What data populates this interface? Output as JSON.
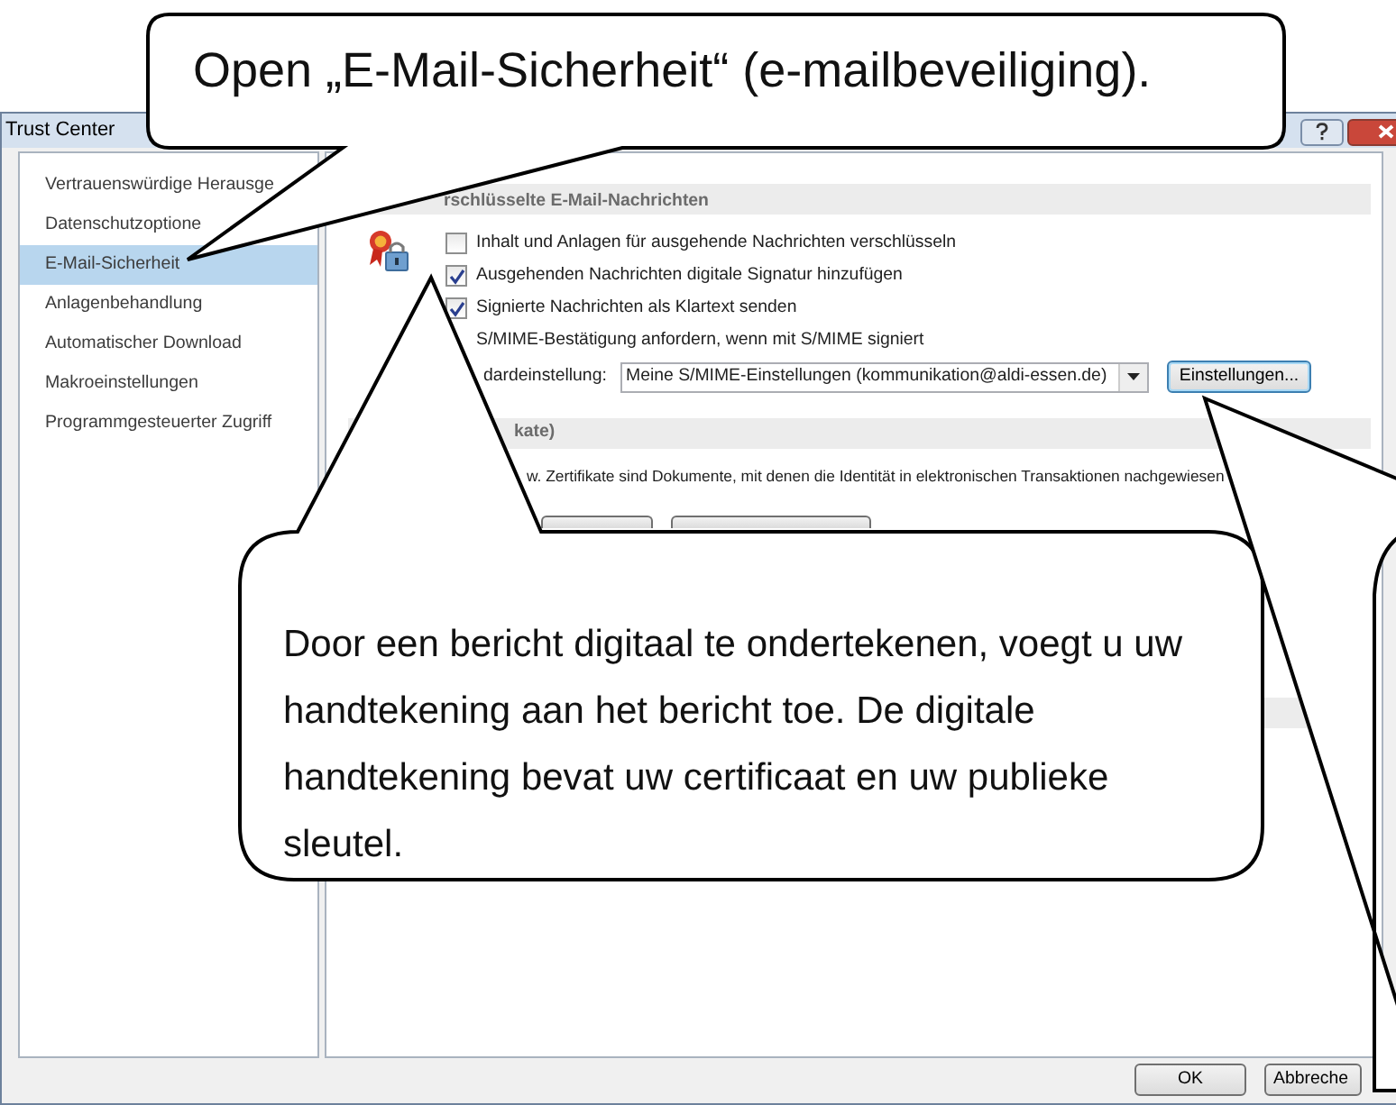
{
  "window": {
    "title": "Trust Center"
  },
  "sidebar": {
    "items": [
      {
        "label": "Vertrauenswürdige Herausge",
        "selected": false
      },
      {
        "label": "Datenschutzoptione",
        "selected": false
      },
      {
        "label": "E-Mail-Sicherheit",
        "selected": true
      },
      {
        "label": "Anlagenbehandlung",
        "selected": false
      },
      {
        "label": "Automatischer Download",
        "selected": false
      },
      {
        "label": "Makroeinstellungen",
        "selected": false
      },
      {
        "label": "Programmgesteuerter Zugriff",
        "selected": false
      }
    ]
  },
  "encryption": {
    "title": "rschlüsselte E-Mail-Nachrichten",
    "options": [
      {
        "label": "Inhalt und Anlagen für ausgehende Nachrichten verschlüsseln",
        "checked": false
      },
      {
        "label": "Ausgehenden Nachrichten digitale Signatur hinzufügen",
        "checked": true
      },
      {
        "label": "Signierte Nachrichten als Klartext senden",
        "checked": true
      },
      {
        "label": "S/MIME-Bestätigung anfordern, wenn mit S/MIME signiert"
      }
    ],
    "default_setting": {
      "label": "dardeinstellung:",
      "value": "Meine S/MIME-Einstellungen (kommunikation@aldi-essen.de)",
      "button": "Einstellungen..."
    }
  },
  "certificates": {
    "title": "kate)",
    "description": "w. Zertifikate sind Dokumente, mit denen die Identität in elektronischen Transaktionen nachgewiesen"
  },
  "buttons": [
    "OK",
    "Abbreche"
  ],
  "callouts": [
    {
      "kind": "note",
      "text": "Open „E-Mail-Sicherheit“ (e-mailbeveiliging)."
    },
    {
      "kind": "note",
      "text": "Door een bericht digitaal te ondertekenen, voegt u uw handtekening aan het bericht toe. De digitale handtekening bevat uw certificaat en uw publieke sleutel."
    },
    {
      "kind": "pointer"
    }
  ]
}
